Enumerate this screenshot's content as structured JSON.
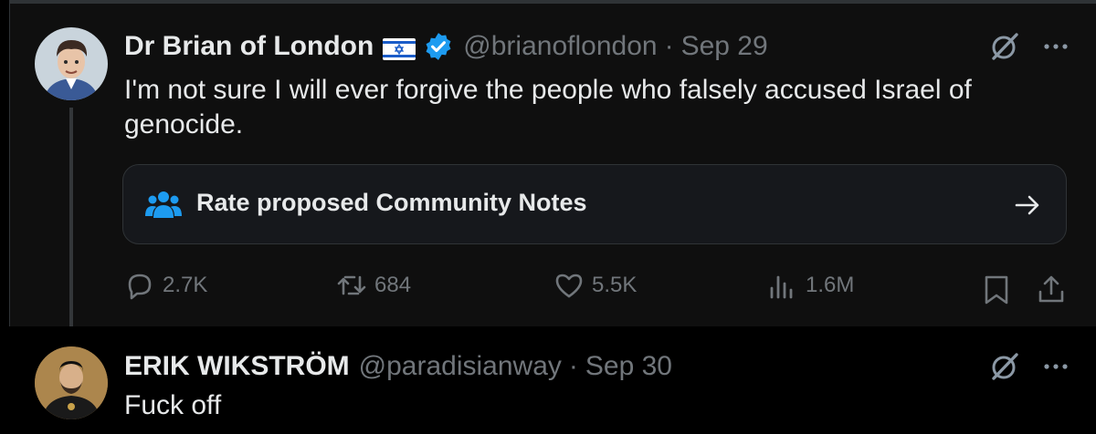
{
  "post1": {
    "author_name": "Dr Brian of London",
    "handle": "@brianoflondon",
    "separator": "·",
    "date": "Sep 29",
    "text_line1": "I'm not sure I will ever forgive the people who falsely accused Israel of",
    "text_line2": "genocide.",
    "community_notes_label": "Rate proposed Community Notes",
    "replies": "2.7K",
    "reposts": "684",
    "likes": "5.5K",
    "views": "1.6M"
  },
  "post2": {
    "author_name": "ERIK WIKSTRÖM",
    "handle": "@paradisianway",
    "separator": "·",
    "date": "Sep 30",
    "text": "Fuck off"
  },
  "icons": [
    "flag-israel-icon",
    "verified-badge-icon",
    "grok-icon",
    "more-icon",
    "community-notes-icon",
    "arrow-right-icon",
    "reply-icon",
    "repost-icon",
    "like-icon",
    "views-icon",
    "bookmark-icon",
    "share-icon"
  ],
  "colors": {
    "background": "#000000",
    "post_bg": "#0f0f0f",
    "text": "#e7e9ea",
    "muted": "#71767b",
    "accent": "#1d9bf0",
    "border": "#2f3336"
  }
}
